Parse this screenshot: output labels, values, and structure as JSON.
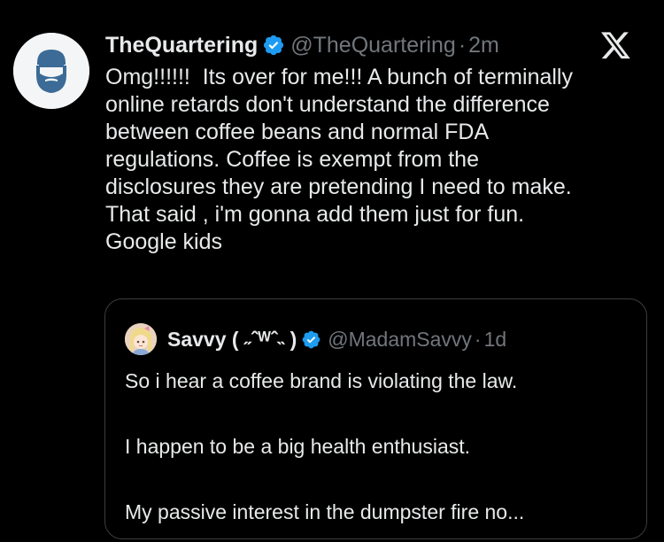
{
  "tweet": {
    "author": {
      "display_name": "TheQuartering",
      "handle": "@TheQuartering",
      "verified": true,
      "avatar_icon": "bearded-man-icon"
    },
    "separator": "·",
    "time": "2m",
    "platform_logo": "x-logo-icon",
    "text": "Omg!!!!!!  Its over for me!!! A bunch of terminally\nonline retards don't understand the difference\nbetween coffee beans and normal FDA\nregulations. Coffee is exempt from the\ndisclosures they are pretending I need to make.\nThat said , i'm gonna add them just for fun.\nGoogle kids"
  },
  "quoted_tweet": {
    "author": {
      "display_name": "Savvy ( ˶ˆᵂˆ˵ )",
      "handle": "@MadamSavvy",
      "verified": true,
      "avatar_icon": "anime-girl-avatar-icon"
    },
    "separator": "·",
    "time": "1d",
    "lines": [
      "So i hear a coffee brand is violating the law.",
      "I happen to be a big health enthusiast.",
      "My passive interest in the dumpster fire no..."
    ]
  },
  "colors": {
    "background": "#000000",
    "text_primary": "#e7e9ea",
    "text_secondary": "#71767b",
    "verified_blue": "#1d9bf0",
    "avatar_accent": "#3b6b96",
    "quote_border": "#3a3d40"
  }
}
